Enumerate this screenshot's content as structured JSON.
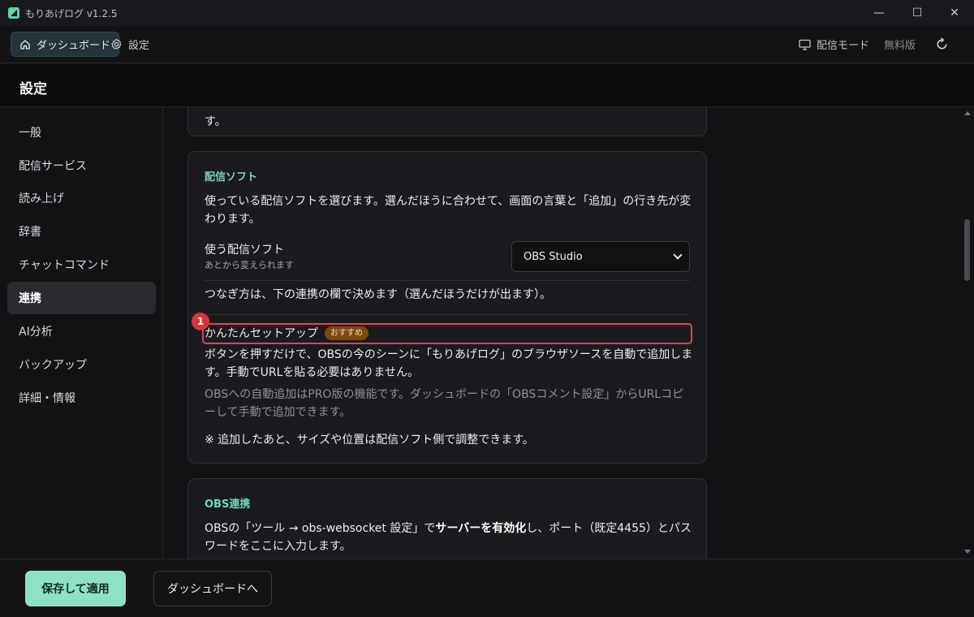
{
  "window": {
    "title": "もりあげログ  v1.2.5",
    "controls": {
      "minimize": "—",
      "maximize": "☐",
      "close": "✕"
    }
  },
  "topnav": {
    "dashboard": "ダッシュボード",
    "settings": "設定",
    "stream_mode": "配信モード",
    "plan": "無料版"
  },
  "page": {
    "title": "設定"
  },
  "sidebar": {
    "items": [
      {
        "label": "一般"
      },
      {
        "label": "配信サービス"
      },
      {
        "label": "読み上げ"
      },
      {
        "label": "辞書"
      },
      {
        "label": "チャットコマンド"
      },
      {
        "label": "連携",
        "active": true
      },
      {
        "label": "AI分析"
      },
      {
        "label": "バックアップ"
      },
      {
        "label": "詳細・情報"
      }
    ]
  },
  "prev_card": {
    "tail_text": "す。"
  },
  "streaming_software": {
    "title": "配信ソフト",
    "description": "使っている配信ソフトを選びます。選んだほうに合わせて、画面の言葉と「追加」の行き先が変わります。",
    "select_label": "使う配信ソフト",
    "select_hint": "あとから変えられます",
    "select_value": "OBS Studio",
    "connection_note": "つなぎ方は、下の連携の欄で決めます（選んだほうだけが出ます）。",
    "marker_number": "1",
    "easy_setup_label": "かんたんセットアップ",
    "easy_setup_badge": "おすすめ",
    "easy_setup_desc": "ボタンを押すだけで、OBSの今のシーンに「もりあげログ」のブラウザソースを自動で追加します。手動でURLを貼る必要はありません。",
    "pro_note": "OBSへの自動追加はPRO版の機能です。ダッシュボードの「OBSコメント設定」からURLコピーして手動で追加できます。",
    "adjust_note": "※ 追加したあと、サイズや位置は配信ソフト側で調整できます。"
  },
  "obs_link": {
    "title": "OBS連携",
    "desc_part1": "OBSの「ツール → obs-websocket 設定」で",
    "desc_bold": "サーバーを有効化",
    "desc_part2": "し、ポート（既定4455）とパスワードをここに入力します。"
  },
  "footer": {
    "save_apply": "保存して適用",
    "to_dashboard": "ダッシュボードへ"
  },
  "colors": {
    "accent": "#6fd8b8",
    "primary_button": "#8fe1c5",
    "highlight": "#e0454f",
    "badge": "#7a4a12"
  }
}
